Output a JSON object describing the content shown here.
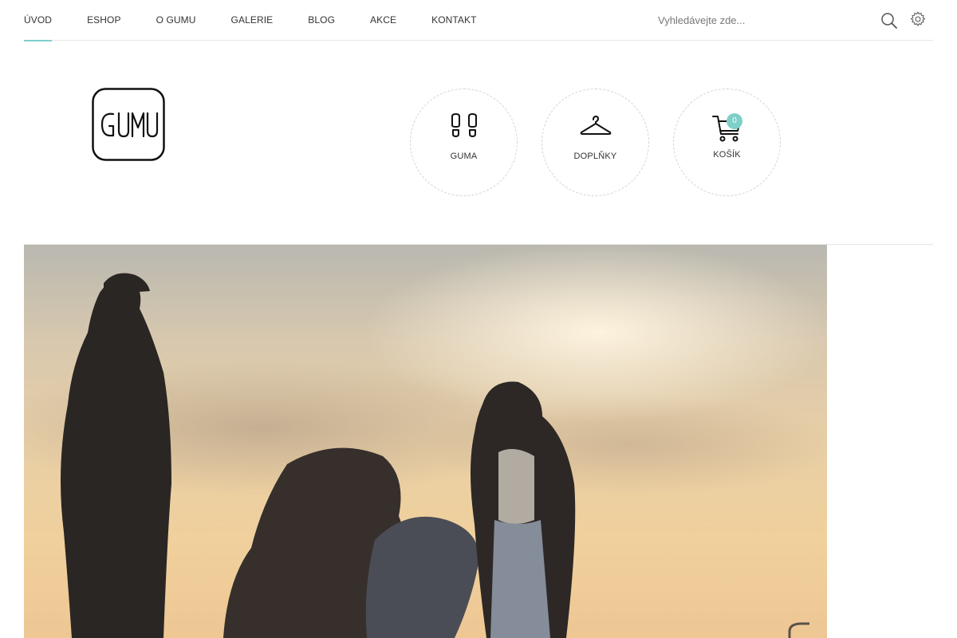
{
  "nav": {
    "items": [
      {
        "label": "ÚVOD",
        "active": true
      },
      {
        "label": "ESHOP",
        "active": false
      },
      {
        "label": "O GUMU",
        "active": false
      },
      {
        "label": "GALERIE",
        "active": false
      },
      {
        "label": "BLOG",
        "active": false
      },
      {
        "label": "AKCE",
        "active": false
      },
      {
        "label": "KONTAKT",
        "active": false
      }
    ],
    "search_placeholder": "Vyhledávejte zde...",
    "accent_color": "#7fcfc9"
  },
  "logo": {
    "text": "GUMU"
  },
  "categories": [
    {
      "label": "GUMA",
      "icon": "shoe-prints-icon"
    },
    {
      "label": "DOPLŇKY",
      "icon": "hanger-icon"
    }
  ],
  "cart": {
    "label": "KOŠÍK",
    "count": "0",
    "icon": "cart-icon"
  },
  "hero": {
    "description_icon": "hero-photo"
  }
}
